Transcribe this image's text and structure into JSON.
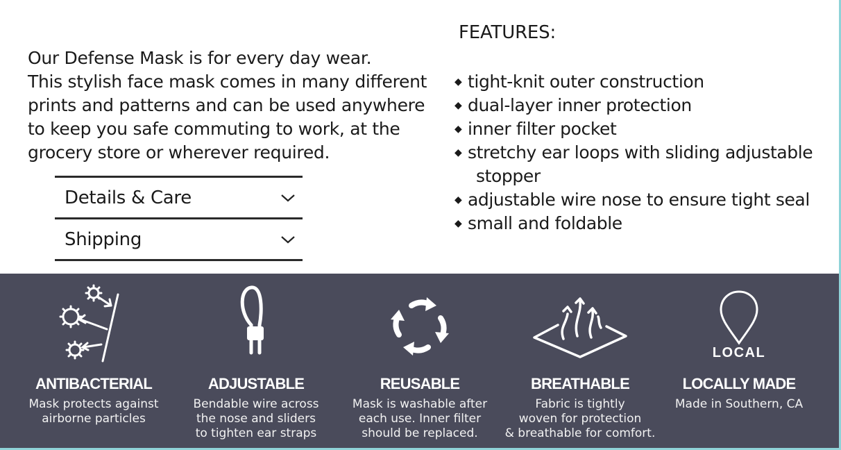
{
  "intro": {
    "line1": "Our Defense Mask is for every day wear.",
    "line2": "This stylish face mask comes in many different",
    "line3": "prints and patterns and can be used anywhere",
    "line4": "to keep you safe commuting to work, at the",
    "line5": "grocery store or wherever required."
  },
  "accordion": {
    "items": [
      {
        "label": "Details & Care",
        "icon": "chevron-down-icon"
      },
      {
        "label": "Shipping",
        "icon": "chevron-down-icon"
      }
    ]
  },
  "features": {
    "title": "FEATURES:",
    "bullet": "◆",
    "items": [
      {
        "text": "tight-knit outer construction"
      },
      {
        "text": "dual-layer inner protection"
      },
      {
        "text": "inner filter pocket"
      },
      {
        "text": "stretchy ear loops with sliding adjustable",
        "text2": "stopper"
      },
      {
        "text": "adjustable wire nose to ensure tight seal"
      },
      {
        "text": "small and foldable"
      }
    ]
  },
  "benefits": {
    "background": "#4a4b5b",
    "items": [
      {
        "icon": "antibacterial-icon",
        "title": "ANTIBACTERIAL",
        "desc1": "Mask protects against",
        "desc2": "airborne particles",
        "desc3": ""
      },
      {
        "icon": "adjustable-loop-icon",
        "title": "ADJUSTABLE",
        "desc1": "Bendable wire across",
        "desc2": "the nose and sliders",
        "desc3": "to tighten ear straps"
      },
      {
        "icon": "reusable-arrows-icon",
        "title": "REUSABLE",
        "desc1": "Mask is washable after",
        "desc2": "each use. Inner filter",
        "desc3": "should be replaced."
      },
      {
        "icon": "breathable-fabric-icon",
        "title": "BREATHABLE",
        "desc1": "Fabric is tightly",
        "desc2": "woven for protection",
        "desc3": "& breathable for comfort."
      },
      {
        "icon": "local-pin-icon",
        "icon_text": "LOCAL",
        "title": "LOCALLY MADE",
        "desc1": "Made in Southern, CA",
        "desc2": "",
        "desc3": ""
      }
    ]
  },
  "colors": {
    "frame_accent": "#8fd3d8",
    "text": "#1a1a1a"
  }
}
